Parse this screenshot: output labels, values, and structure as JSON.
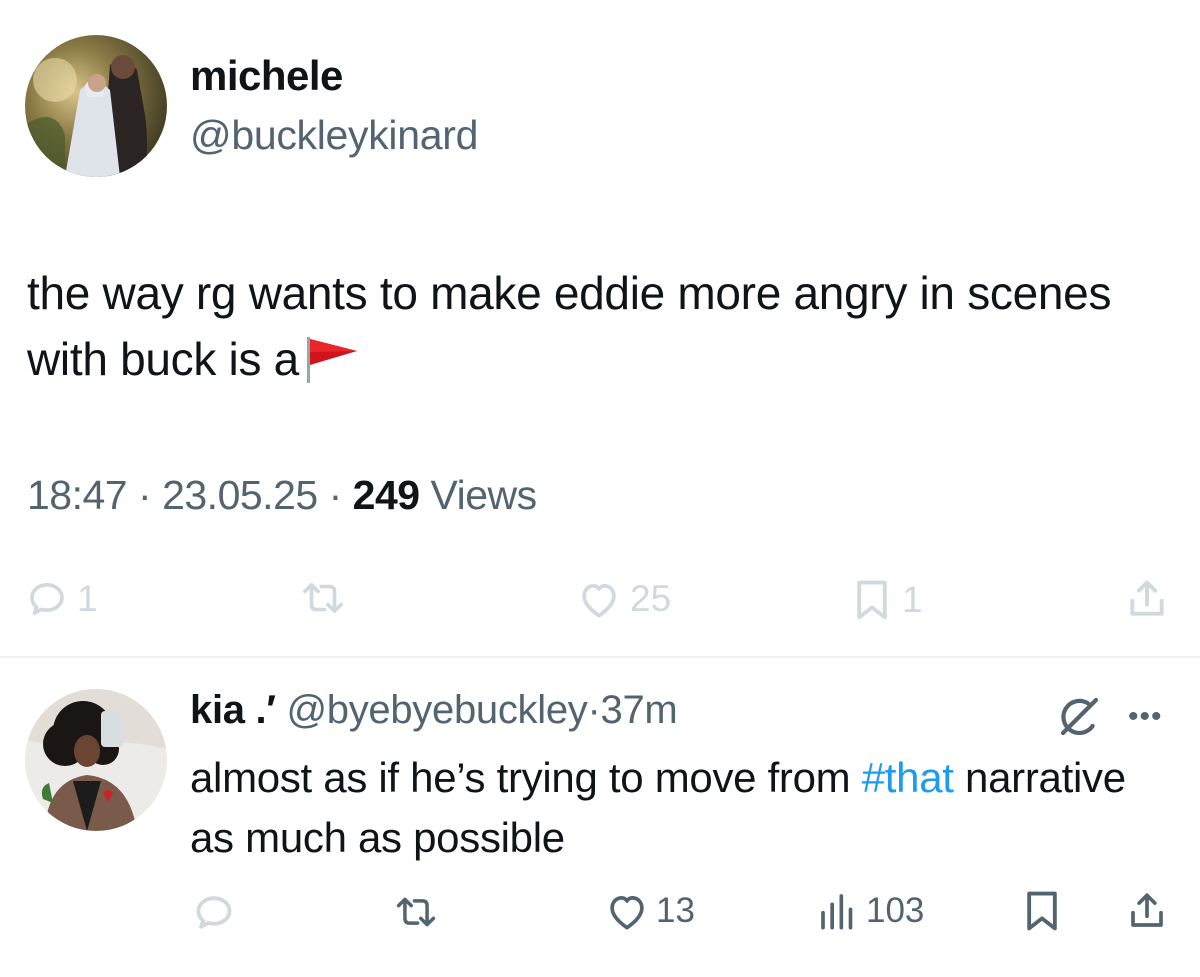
{
  "main_tweet": {
    "author_name": "michele",
    "author_handle": "@buckleykinard",
    "text": "the way rg wants to make eddie more angry in scenes with buck is a",
    "emoji": "red-flag-emoji",
    "time": "18:47",
    "date": "23.05.25",
    "views_count": "249",
    "views_label": "Views",
    "separator": "·",
    "actions": {
      "reply_count": "1",
      "retweet_count": "",
      "like_count": "25",
      "bookmark_count": "1"
    }
  },
  "reply": {
    "author_name": "kia .′",
    "author_handle": "@byebyebuckley",
    "separator": "·",
    "time": "37m",
    "text_before": "almost as if he’s trying to move from ",
    "hashtag": "#that",
    "text_after": " narrative as much as possible",
    "more_label": "•••",
    "actions": {
      "reply_count": "",
      "retweet_count": "",
      "like_count": "13",
      "views_count": "103"
    }
  },
  "colors": {
    "text": "#0f1419",
    "muted": "#536471",
    "disabled": "#cfd9de",
    "link": "#1d9bf0",
    "divider": "#eff3f4"
  }
}
